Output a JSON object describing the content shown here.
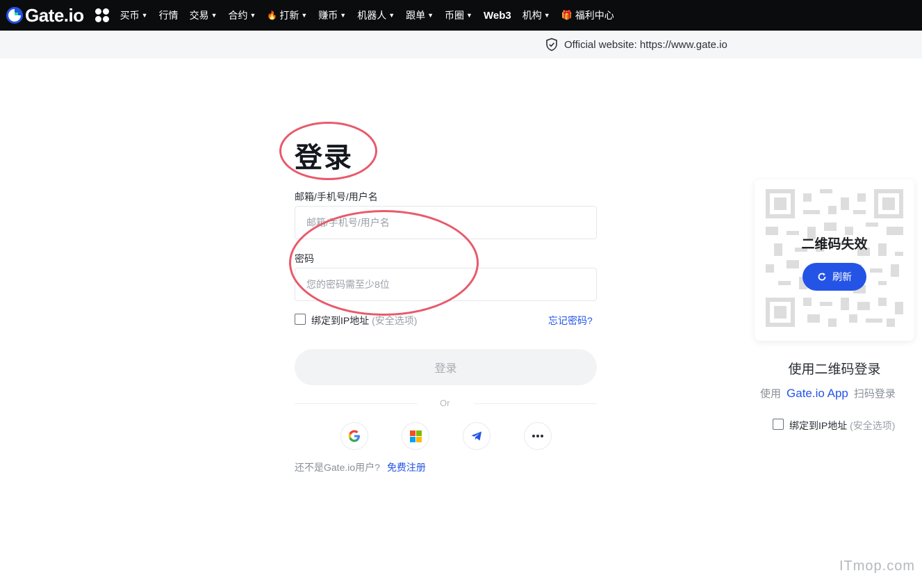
{
  "nav": {
    "brand": "Gate.io",
    "items": [
      {
        "label": "买币",
        "caret": true
      },
      {
        "label": "行情",
        "caret": false
      },
      {
        "label": "交易",
        "caret": true
      },
      {
        "label": "合约",
        "caret": true
      },
      {
        "label": "打新",
        "caret": true,
        "icon": "fire-icon"
      },
      {
        "label": "赚币",
        "caret": true
      },
      {
        "label": "机器人",
        "caret": true
      },
      {
        "label": "跟单",
        "caret": true
      },
      {
        "label": "币圈",
        "caret": true
      },
      {
        "label": "Web3",
        "caret": false,
        "bold": true
      },
      {
        "label": "机构",
        "caret": true
      },
      {
        "label": "福利中心",
        "caret": false,
        "icon": "gift-icon"
      }
    ]
  },
  "official_bar": {
    "text": "Official website: https://www.gate.io",
    "icon": "shield-check-icon"
  },
  "login": {
    "title": "登录",
    "account_label": "邮箱/手机号/用户名",
    "account_placeholder": "邮箱/手机号/用户名",
    "password_label": "密码",
    "password_placeholder": "您的密码需至少8位",
    "bind_ip_label": "绑定到IP地址",
    "bind_ip_note": "(安全选项)",
    "forgot": "忘记密码?",
    "submit": "登录",
    "or": "Or",
    "social": [
      {
        "name": "google-icon"
      },
      {
        "name": "microsoft-icon"
      },
      {
        "name": "telegram-icon"
      },
      {
        "name": "more-icon"
      }
    ],
    "signup_prompt": "还不是Gate.io用户?",
    "signup_link": "免费注册"
  },
  "qr": {
    "expired": "二维码失效",
    "refresh": "刷新",
    "title": "使用二维码登录",
    "sub_pre": "使用",
    "sub_app": "Gate.io App",
    "sub_post": "扫码登录",
    "bind_ip_label": "绑定到IP地址",
    "bind_ip_note": "(安全选项)"
  },
  "watermark": "ITmop.com",
  "colors": {
    "accent": "#2354e6",
    "annotation": "#e85a6b",
    "nav_bg": "#0b0c0e"
  }
}
